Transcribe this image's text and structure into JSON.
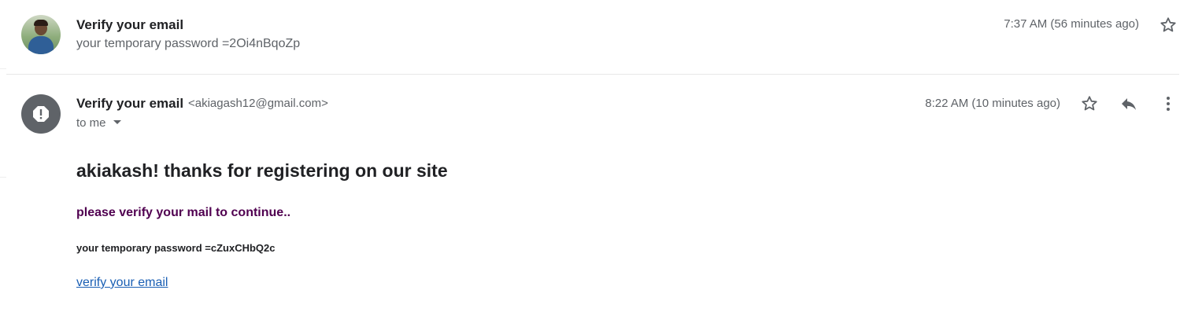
{
  "thread": {
    "collapsed_message": {
      "sender": "Verify your email",
      "snippet": "your temporary password =2Oi4nBqoZp",
      "time": "7:37 AM (56 minutes ago)",
      "avatar_icon": "user-photo-avatar",
      "star_icon": "star-outline-icon"
    },
    "expanded_message": {
      "sender": "Verify your email",
      "sender_email": "<akiagash12@gmail.com>",
      "recipient": "to me",
      "time": "8:22 AM (10 minutes ago)",
      "avatar_icon": "warning-icon",
      "actions": {
        "star_icon": "star-outline-icon",
        "reply_icon": "reply-icon",
        "more_icon": "more-vert-icon"
      },
      "body": {
        "heading": "akiakash! thanks for registering on our site",
        "subheading": "please verify your mail to continue..",
        "password_line": "your temporary password =cZuxCHbQ2c",
        "link_text": "verify your email"
      }
    }
  },
  "colors": {
    "text_primary": "#202124",
    "text_secondary": "#5f6368",
    "subheading": "#500050",
    "link": "#1a5fb4",
    "divider": "#e8e8e8"
  }
}
